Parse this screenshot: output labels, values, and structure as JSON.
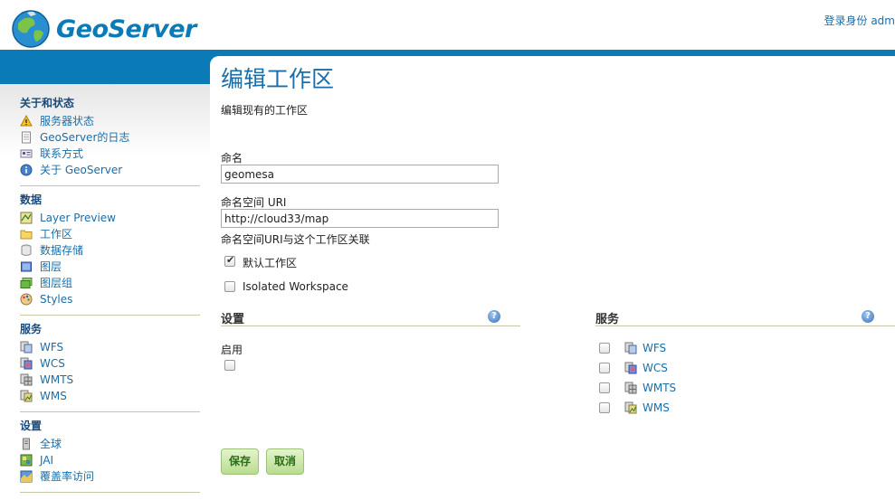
{
  "header": {
    "logo_text": "GeoServer",
    "login_text": "登录身份 adm"
  },
  "sidebar": {
    "sections": [
      {
        "heading": "关于和状态",
        "items": [
          {
            "label": "服务器状态",
            "icon": "warning-icon"
          },
          {
            "label": "GeoServer的日志",
            "icon": "document-icon"
          },
          {
            "label": "联系方式",
            "icon": "contact-card-icon"
          },
          {
            "label": "关于 GeoServer",
            "icon": "info-icon"
          }
        ]
      },
      {
        "heading": "数据",
        "items": [
          {
            "label": "Layer Preview",
            "icon": "map-preview-icon"
          },
          {
            "label": "工作区",
            "icon": "folder-icon"
          },
          {
            "label": "数据存储",
            "icon": "database-icon"
          },
          {
            "label": "图层",
            "icon": "layer-icon"
          },
          {
            "label": "图层组",
            "icon": "layer-group-icon"
          },
          {
            "label": "Styles",
            "icon": "palette-icon"
          }
        ]
      },
      {
        "heading": "服务",
        "items": [
          {
            "label": "WFS",
            "icon": "wfs-icon"
          },
          {
            "label": "WCS",
            "icon": "wcs-icon"
          },
          {
            "label": "WMTS",
            "icon": "wmts-icon"
          },
          {
            "label": "WMS",
            "icon": "wms-icon"
          }
        ]
      },
      {
        "heading": "设置",
        "items": [
          {
            "label": "全球",
            "icon": "server-icon"
          },
          {
            "label": "JAI",
            "icon": "jai-icon"
          },
          {
            "label": "覆盖率访问",
            "icon": "coverage-icon"
          }
        ]
      }
    ]
  },
  "main": {
    "title": "编辑工作区",
    "description": "编辑现有的工作区",
    "name_label": "命名",
    "name_value": "geomesa",
    "uri_label": "命名空间 URI",
    "uri_value": "http://cloud33/map",
    "uri_hint": "命名空间URI与这个工作区关联",
    "default_label": "默认工作区",
    "default_checked": true,
    "isolated_label": "Isolated Workspace",
    "isolated_checked": false,
    "settings": {
      "title": "设置",
      "enabled_label": "启用",
      "enabled_checked": false
    },
    "services": {
      "title": "服务",
      "items": [
        {
          "label": "WFS",
          "icon": "wfs-icon",
          "checked": false
        },
        {
          "label": "WCS",
          "icon": "wcs-icon",
          "checked": false
        },
        {
          "label": "WMTS",
          "icon": "wmts-icon",
          "checked": false
        },
        {
          "label": "WMS",
          "icon": "wms-icon",
          "checked": false
        }
      ]
    },
    "save_label": "保存",
    "cancel_label": "取消"
  },
  "colors": {
    "brand_blue": "#0b7bb8",
    "link_blue": "#1a6ea8",
    "button_green": "#b8dc90"
  }
}
